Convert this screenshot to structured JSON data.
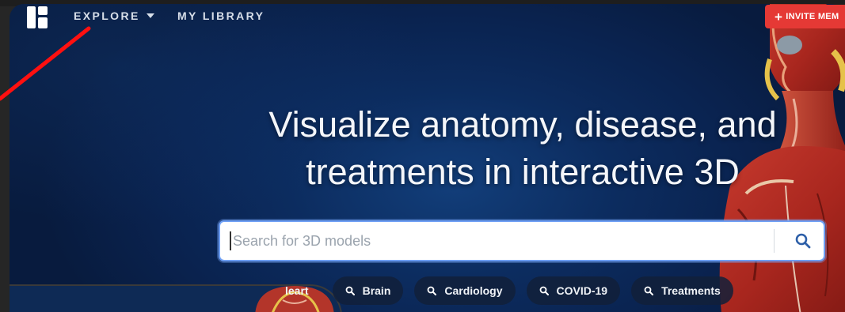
{
  "nav": {
    "explore_label": "EXPLORE",
    "library_label": "MY LIBRARY",
    "logo_icon": "logo-icon",
    "explore_caret_icon": "caret-down-icon"
  },
  "invite": {
    "label": "INVITE MEM",
    "icon": "plus-icon",
    "color": "#e53935"
  },
  "hero": {
    "headline_line1": "Visualize anatomy, disease, and",
    "headline_line2": "treatments in interactive 3D"
  },
  "search": {
    "placeholder": "Search for 3D models",
    "value": "",
    "button_icon": "search-icon"
  },
  "chips": [
    {
      "label": "leart"
    },
    {
      "label": "Brain",
      "icon": "search-icon"
    },
    {
      "label": "Cardiology",
      "icon": "search-icon"
    },
    {
      "label": "COVID-19",
      "icon": "search-icon"
    },
    {
      "label": "Treatments",
      "icon": "search-icon"
    }
  ],
  "colors": {
    "background": "#0a2350",
    "accent": "#e53935",
    "search_border": "#6fa0f5",
    "annotation": "#ff1010"
  }
}
